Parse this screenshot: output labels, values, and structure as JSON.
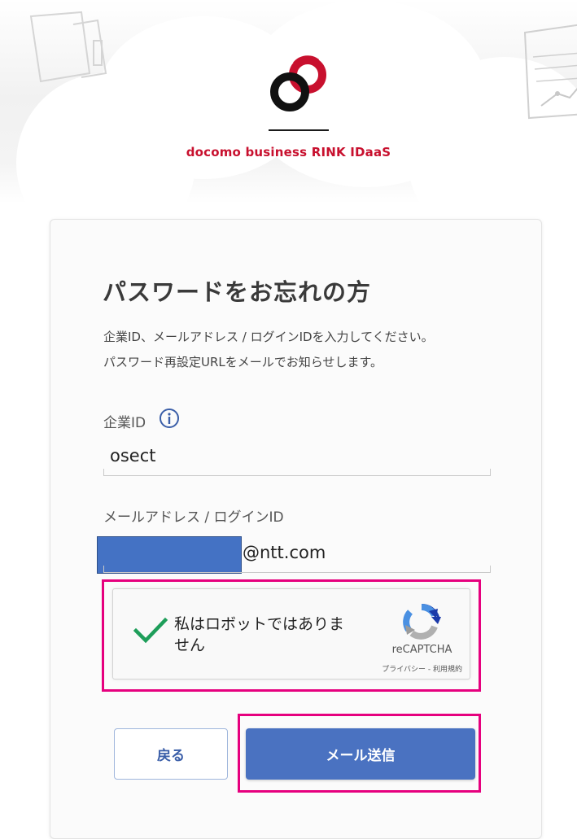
{
  "header": {
    "brand_name": "docomo business RINK IDaaS",
    "logo": "interlocking-rings-logo",
    "colors": {
      "brand_red": "#c8102e",
      "logo_black": "#111111"
    }
  },
  "form": {
    "title": "パスワードをお忘れの方",
    "description_line1": "企業ID、メールアドレス / ログインIDを入力してください。",
    "description_line2": "パスワード再設定URLをメールでお知らせします。",
    "company_id": {
      "label": "企業ID",
      "info_icon": "info-circle-icon",
      "value": "osect"
    },
    "email": {
      "label": "メールアドレス / ログインID",
      "visible_value": "@ntt.com",
      "redacted": true
    }
  },
  "recaptcha": {
    "checked": true,
    "label": "私はロボットではありません",
    "brand": "reCAPTCHA",
    "links": "プライバシー - 利用規約"
  },
  "buttons": {
    "back_label": "戻る",
    "send_label": "メール送信",
    "primary_color": "#4a72c1"
  },
  "highlight_color": "#e6007e"
}
